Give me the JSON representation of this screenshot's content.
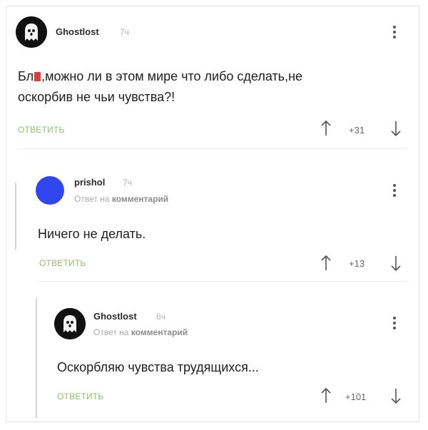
{
  "comments": [
    {
      "username": "Ghostlost",
      "time": "7ч",
      "text_line1": "Бл",
      "text_line1_rest": ",можно ли в этом мире что либо сделать,не",
      "text_line2": "оскорбив не чьи чувства?!",
      "reply_label": "ОТВЕТИТЬ",
      "votes": "+31",
      "avatar_icon": "ghost-avatar-icon"
    },
    {
      "username": "prishol",
      "time": "7ч",
      "reply_prefix": "Ответ на",
      "reply_target": "комментарий",
      "text": "Ничего не делать.",
      "reply_label": "ОТВЕТИТЬ",
      "votes": "+13",
      "avatar_color": "#3246f0"
    },
    {
      "username": "Ghostlost",
      "time": "6ч",
      "reply_prefix": "Ответ на",
      "reply_target": "комментарий",
      "text": "Оскорбляю чувства трудящихся...",
      "reply_label": "ОТВЕТИТЬ",
      "votes": "+101",
      "avatar_icon": "ghost-avatar-icon"
    }
  ],
  "colors": {
    "accent_green": "#8fc06a",
    "censor_red": "#e23b3b",
    "avatar_blue": "#3246f0"
  }
}
